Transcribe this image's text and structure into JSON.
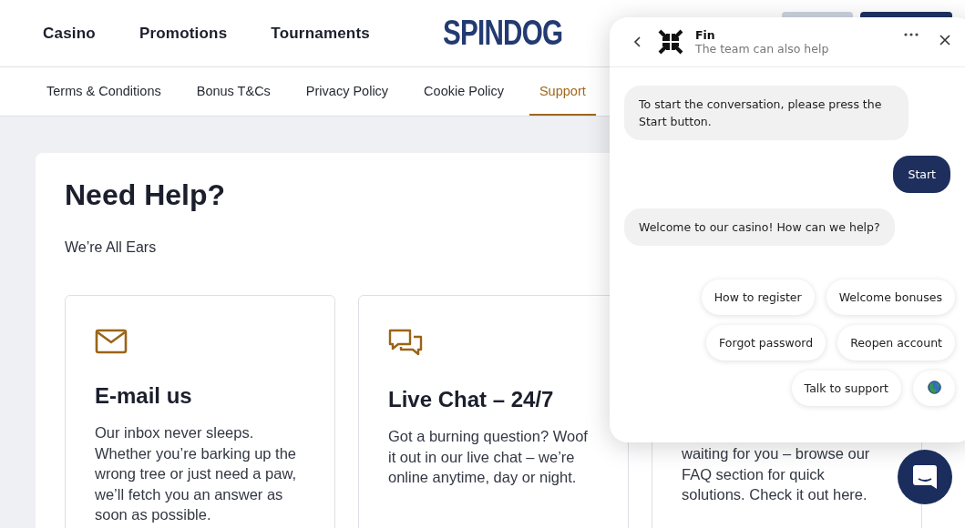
{
  "header": {
    "nav": [
      "Casino",
      "Promotions",
      "Tournaments"
    ],
    "logo": "SPINDOG"
  },
  "subnav": [
    {
      "label": "Terms & Conditions",
      "selected": false
    },
    {
      "label": "Bonus T&Cs",
      "selected": false
    },
    {
      "label": "Privacy Policy",
      "selected": false
    },
    {
      "label": "Cookie Policy",
      "selected": false
    },
    {
      "label": "Support",
      "selected": true
    }
  ],
  "help": {
    "title": "Need Help?",
    "subtitle": "We’re All Ears",
    "cards": [
      {
        "kind": "mail",
        "title": "E-mail us",
        "text": "Our inbox never sleeps. Whether you’re barking up the wrong tree or just need a paw, we’ll fetch you an answer as soon as possible."
      },
      {
        "kind": "chat",
        "title": "Live Chat – 24/7",
        "text": "Got a burning question? Woof it out in our live chat – we’re online anytime, day or night."
      },
      {
        "kind": "covered",
        "text": "waiting for you – browse our FAQ section for quick solutions. Check it out here."
      }
    ]
  },
  "chat": {
    "name": "Fin",
    "subtitle": "The team can also help",
    "messages": [
      {
        "kind": "bot",
        "text": "To start the conversation, please press the Start button."
      },
      {
        "kind": "user",
        "text": "Start"
      },
      {
        "kind": "bot",
        "text": "Welcome to our casino! How can we help?"
      }
    ],
    "quick_replies": [
      [
        {
          "kind": "text",
          "label": "How to register"
        },
        {
          "kind": "text",
          "label": "Welcome bonuses"
        }
      ],
      [
        {
          "kind": "text",
          "label": "Forgot password"
        },
        {
          "kind": "text",
          "label": "Reopen account"
        }
      ],
      [
        {
          "kind": "text",
          "label": "Talk to support"
        },
        {
          "kind": "globe"
        }
      ]
    ]
  }
}
